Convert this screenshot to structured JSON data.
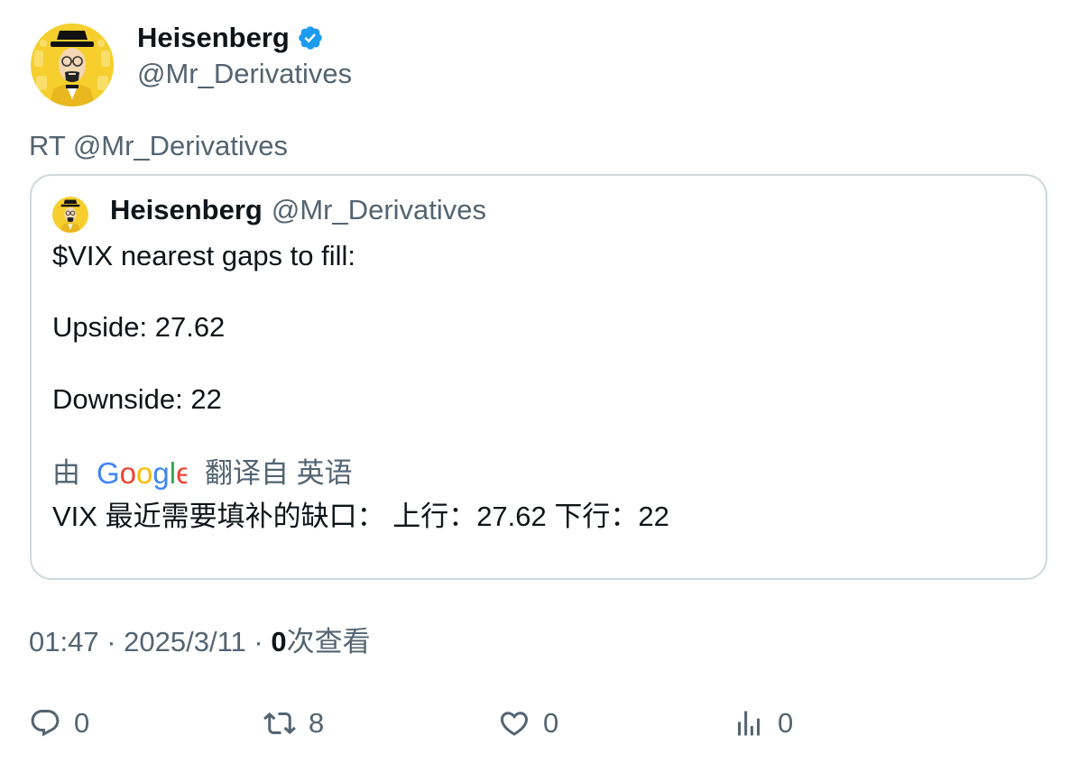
{
  "author": {
    "display_name": "Heisenberg",
    "handle": "@Mr_Derivatives",
    "verified_icon": "verified-badge-icon",
    "avatar": "heisenberg-avatar"
  },
  "retweet": {
    "text": "RT @Mr_Derivatives"
  },
  "quote": {
    "display_name": "Heisenberg",
    "handle": "@Mr_Derivatives",
    "lines": [
      "$VIX nearest gaps to fill:",
      "Upside: 27.62",
      "Downside: 22"
    ],
    "translate_prefix": "由",
    "translate_brand": "Google",
    "translate_suffix": "翻译自 英语",
    "translated_text": "VIX 最近需要填补的缺口： 上行：27.62 下行：22"
  },
  "meta": {
    "time": "01:47",
    "sep1": " · ",
    "date": "2025/3/11",
    "sep2": " · ",
    "views_count": "0",
    "views_label": "次查看"
  },
  "actions": {
    "reply_count": "0",
    "retweet_count": "8",
    "like_count": "0",
    "views_count": "0"
  },
  "colors": {
    "text_primary": "#0f1419",
    "text_secondary": "#536471",
    "verified_blue": "#1d9bf0",
    "border": "#cfd9de",
    "avatar_bg": "#f6cf2f"
  }
}
